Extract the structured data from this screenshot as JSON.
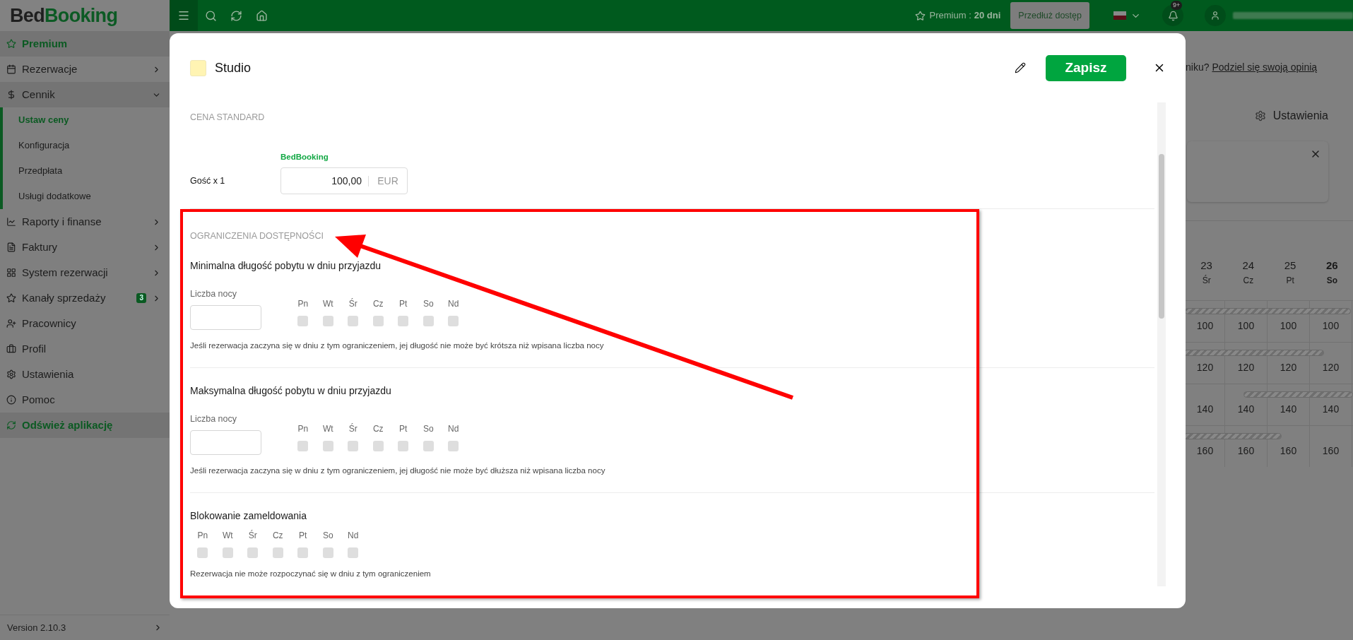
{
  "logo": {
    "dark": "Bed",
    "green": "Booking"
  },
  "topbar": {
    "premium_label": "Premium :",
    "premium_days": "20 dni",
    "extend_button": "Przedłuż dostęp",
    "notification_badge": "9+"
  },
  "sidebar": {
    "items": [
      {
        "label": "Premium",
        "kind": "highlight"
      },
      {
        "label": "Rezerwacje",
        "kind": "item",
        "expanded": false
      },
      {
        "label": "Cennik",
        "kind": "item",
        "expanded": true,
        "children": [
          {
            "label": "Ustaw ceny",
            "selected": true
          },
          {
            "label": "Konfiguracja",
            "selected": false
          },
          {
            "label": "Przedpłata",
            "selected": false
          },
          {
            "label": "Usługi dodatkowe",
            "selected": false
          }
        ]
      },
      {
        "label": "Raporty i finanse",
        "kind": "item",
        "expanded": false
      },
      {
        "label": "Faktury",
        "kind": "item",
        "expanded": false
      },
      {
        "label": "System rezerwacji",
        "kind": "item",
        "expanded": false
      },
      {
        "label": "Kanały sprzedaży",
        "kind": "item",
        "expanded": false,
        "badge": "3"
      },
      {
        "label": "Pracownicy",
        "kind": "item"
      },
      {
        "label": "Profil",
        "kind": "item"
      },
      {
        "label": "Ustawienia",
        "kind": "item"
      },
      {
        "label": "Pomoc",
        "kind": "item"
      },
      {
        "label": "Odśwież aplikację",
        "kind": "highlight"
      }
    ],
    "version": "Version 2.10.3"
  },
  "background": {
    "feedback_prefix": "niku?",
    "feedback_link": "Podziel się swoją opinią",
    "settings_label": "Ustawienia",
    "calendar": {
      "days": [
        {
          "date": "23",
          "weekday": "Śr",
          "today": false
        },
        {
          "date": "24",
          "weekday": "Cz",
          "today": false
        },
        {
          "date": "25",
          "weekday": "Pt",
          "today": false
        },
        {
          "date": "26",
          "weekday": "So",
          "today": true
        }
      ],
      "rows": [
        [
          "100",
          "100",
          "100",
          "100"
        ],
        [
          "120",
          "120",
          "120",
          "120"
        ],
        [
          "140",
          "140",
          "140",
          "140"
        ],
        [
          "160",
          "160",
          "160",
          "160"
        ]
      ]
    }
  },
  "modal": {
    "title": "Studio",
    "save_button": "Zapisz",
    "standard_price": {
      "heading": "CENA STANDARD",
      "channel": "BedBooking",
      "rows": [
        {
          "label": "Gość x 1",
          "value": "100,00",
          "currency": "EUR"
        }
      ]
    },
    "restrictions": {
      "heading": "OGRANICZENIA DOSTĘPNOŚCI",
      "groups": [
        {
          "kind": "nights",
          "title": "Minimalna długość pobytu w dniu przyjazdu",
          "field_label": "Liczba nocy",
          "hint": "Jeśli rezerwacja zaczyna się w dniu z tym ograniczeniem, jej długość nie może być krótsza niż wpisana liczba nocy",
          "days": [
            {
              "label": "Pn",
              "checked": false
            },
            {
              "label": "Wt",
              "checked": false
            },
            {
              "label": "Śr",
              "checked": false
            },
            {
              "label": "Cz",
              "checked": false
            },
            {
              "label": "Pt",
              "checked": false
            },
            {
              "label": "So",
              "checked": false
            },
            {
              "label": "Nd",
              "checked": false
            }
          ]
        },
        {
          "kind": "nights",
          "title": "Maksymalna długość pobytu w dniu przyjazdu",
          "field_label": "Liczba nocy",
          "hint": "Jeśli rezerwacja zaczyna się w dniu z tym ograniczeniem, jej długość nie może być dłuższa niż wpisana liczba nocy",
          "days": [
            {
              "label": "Pn",
              "checked": false
            },
            {
              "label": "Wt",
              "checked": false
            },
            {
              "label": "Śr",
              "checked": false
            },
            {
              "label": "Cz",
              "checked": false
            },
            {
              "label": "Pt",
              "checked": false
            },
            {
              "label": "So",
              "checked": false
            },
            {
              "label": "Nd",
              "checked": false
            }
          ]
        },
        {
          "kind": "days",
          "title": "Blokowanie zameldowania",
          "hint": "Rezerwacja nie może rozpoczynać się w dniu z tym ograniczeniem",
          "days": [
            {
              "label": "Pn",
              "checked": false
            },
            {
              "label": "Wt",
              "checked": false
            },
            {
              "label": "Śr",
              "checked": false
            },
            {
              "label": "Cz",
              "checked": false
            },
            {
              "label": "Pt",
              "checked": false
            },
            {
              "label": "So",
              "checked": false
            },
            {
              "label": "Nd",
              "checked": false
            }
          ]
        }
      ]
    }
  }
}
